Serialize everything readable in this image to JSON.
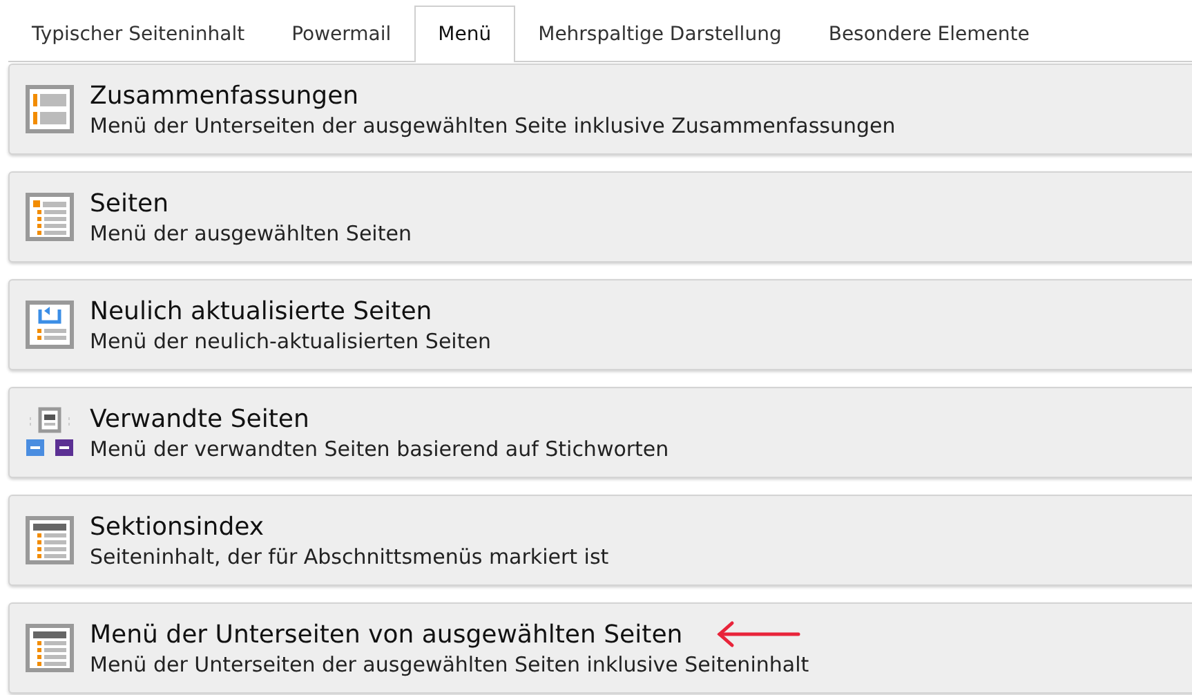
{
  "tabs": [
    {
      "label": "Typischer Seiteninhalt",
      "selected": false
    },
    {
      "label": "Powermail",
      "selected": false
    },
    {
      "label": "Menü",
      "selected": true
    },
    {
      "label": "Mehrspaltige Darstellung",
      "selected": false
    },
    {
      "label": "Besondere Elemente",
      "selected": false
    }
  ],
  "items": [
    {
      "kind": "abstract",
      "title": "Zusammenfassungen",
      "description": "Menü der Unterseiten der ausgewählten Seite inklusive Zusammenfassungen",
      "marked": false
    },
    {
      "kind": "pages",
      "title": "Seiten",
      "description": "Menü der ausgewählten Seiten",
      "marked": false
    },
    {
      "kind": "updated",
      "title": "Neulich aktualisierte Seiten",
      "description": "Menü der neulich-aktualisierten Seiten",
      "marked": false
    },
    {
      "kind": "related",
      "title": "Verwandte Seiten",
      "description": "Menü der verwandten Seiten basierend auf Stichworten",
      "marked": false
    },
    {
      "kind": "section",
      "title": "Sektionsindex",
      "description": "Seiteninhalt, der für Abschnittsmenüs markiert ist",
      "marked": false
    },
    {
      "kind": "subpages",
      "title": "Menü der Unterseiten von ausgewählten Seiten",
      "description": "Menü der Unterseiten der ausgewählten Seiten inklusive Seiteninhalt",
      "marked": true
    }
  ]
}
